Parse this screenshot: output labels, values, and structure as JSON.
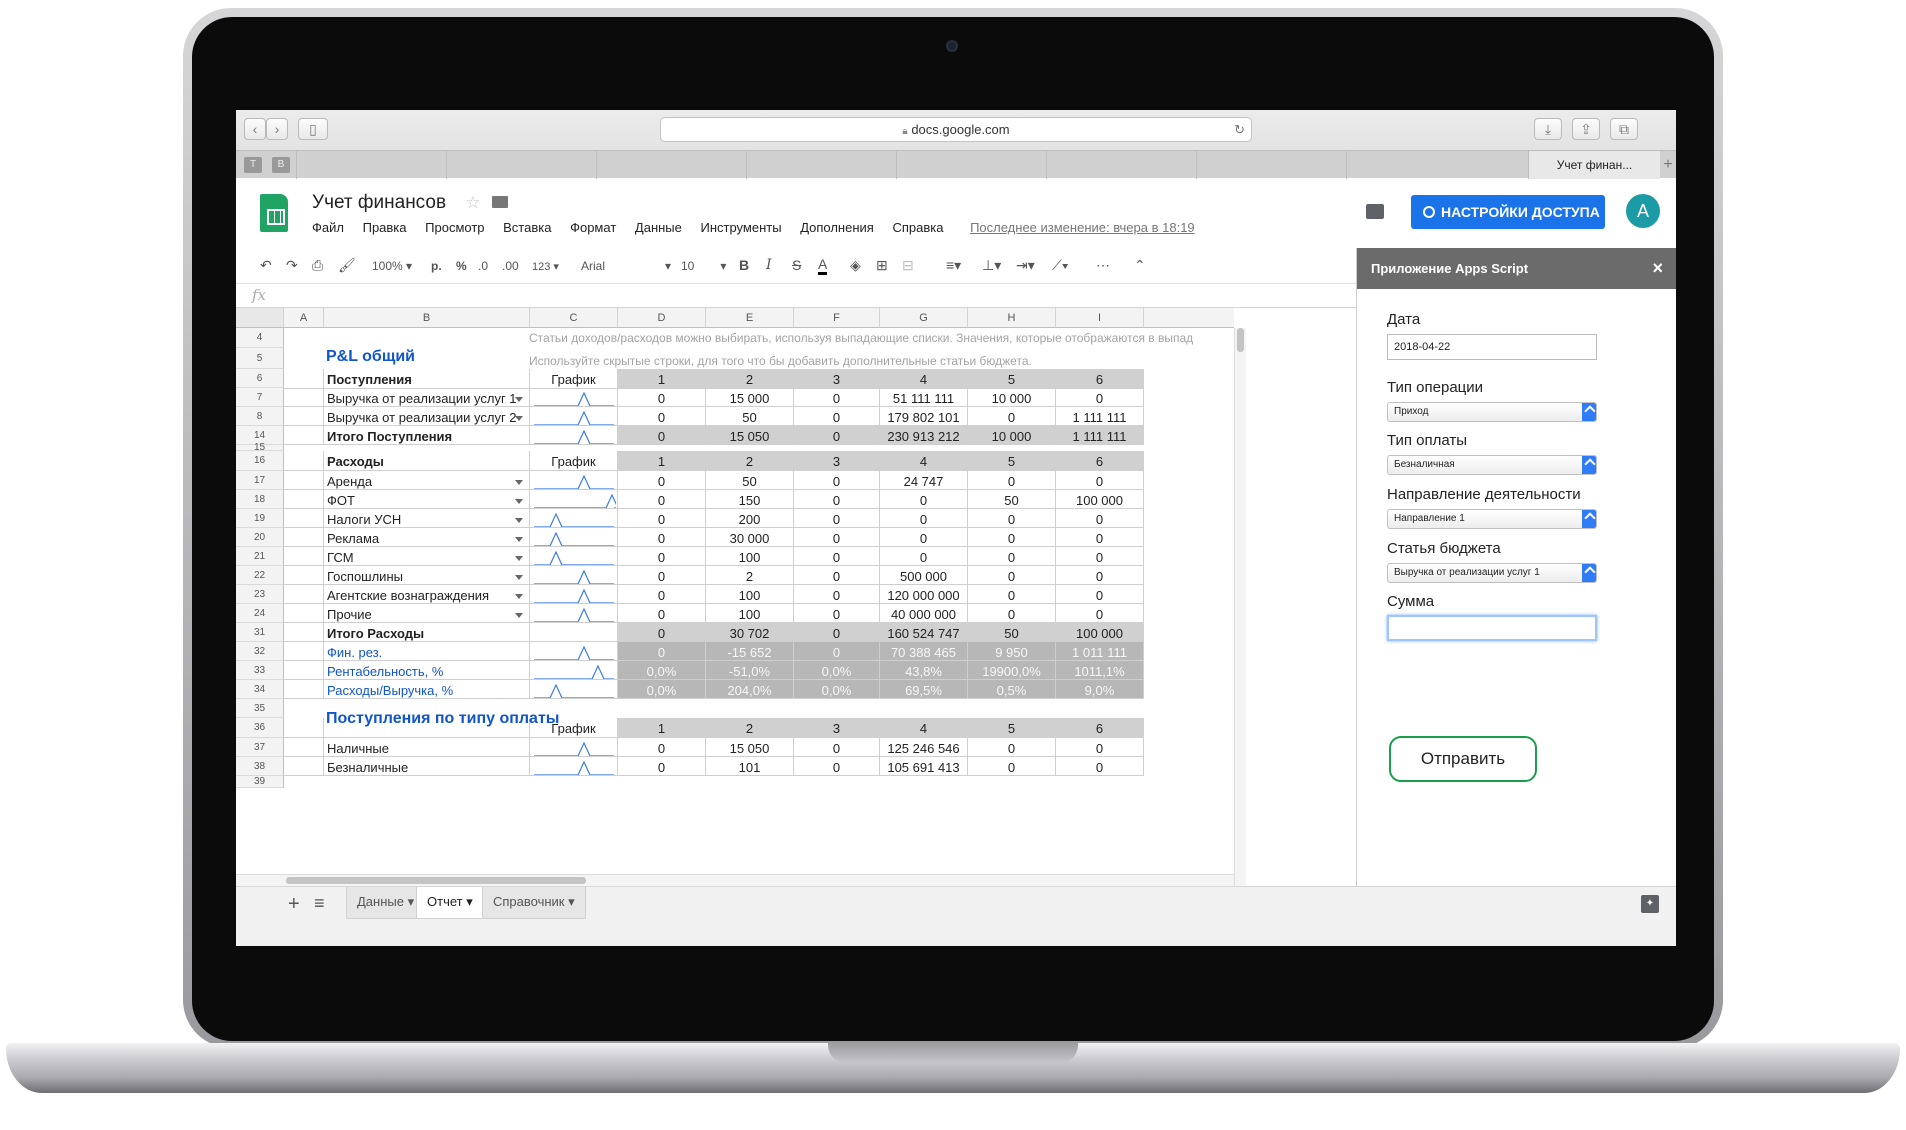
{
  "browser": {
    "url": "docs.google.com",
    "tab_title": "Учет финан...",
    "favicons": [
      "T",
      "B"
    ]
  },
  "header": {
    "title": "Учет финансов",
    "menu": [
      "Файл",
      "Правка",
      "Просмотр",
      "Вставка",
      "Формат",
      "Данные",
      "Инструменты",
      "Дополнения",
      "Справка"
    ],
    "last_edit": "Последнее изменение: вчера в 18:19",
    "share_label": "НАСТРОЙКИ ДОСТУПА",
    "avatar_letter": "A"
  },
  "toolbar": {
    "zoom": "100%",
    "currency": "р.",
    "percent": "%",
    "dec_less": ".0",
    "dec_more": ".00",
    "more_formats": "123",
    "font": "Arial",
    "size": "10",
    "bold": "B",
    "italic": "I",
    "strike": "S",
    "text_color": "A"
  },
  "formula_bar": {
    "fx": "fx",
    "value": ""
  },
  "grid": {
    "columns": [
      "A",
      "B",
      "C",
      "D",
      "E",
      "F",
      "G",
      "H",
      "I"
    ],
    "hint_line1": "Статьи доходов/расходов можно выбирать, используя выпадающие списки. Значения, которые отображаются в выпад",
    "hint_line2": "Используйте скрытые строки, для того что бы добавить дополнительные статьи бюджета.",
    "section_title": "P&L общий",
    "income": {
      "header": {
        "label": "Поступления",
        "chart": "График",
        "periods": [
          "1",
          "2",
          "3",
          "4",
          "5",
          "6"
        ]
      },
      "rows": [
        {
          "num": "7",
          "label": "Выручка от реализации услуг 1",
          "values": [
            "0",
            "15 000",
            "0",
            "51 111 111",
            "10 000",
            "0"
          ]
        },
        {
          "num": "8",
          "label": "Выручка от реализации услуг 2",
          "values": [
            "0",
            "50",
            "0",
            "179 802 101",
            "0",
            "1 111 111"
          ]
        }
      ],
      "total": {
        "num": "14",
        "label": "Итого Поступления",
        "values": [
          "0",
          "15 050",
          "0",
          "230 913 212",
          "10 000",
          "1 111 111"
        ]
      }
    },
    "expenses": {
      "header": {
        "label": "Расходы",
        "chart": "График",
        "periods": [
          "1",
          "2",
          "3",
          "4",
          "5",
          "6"
        ]
      },
      "rows": [
        {
          "num": "17",
          "label": "Аренда",
          "values": [
            "0",
            "50",
            "0",
            "24 747",
            "0",
            "0"
          ]
        },
        {
          "num": "18",
          "label": "ФОТ",
          "values": [
            "0",
            "150",
            "0",
            "0",
            "50",
            "100 000"
          ]
        },
        {
          "num": "19",
          "label": "Налоги УСН",
          "values": [
            "0",
            "200",
            "0",
            "0",
            "0",
            "0"
          ]
        },
        {
          "num": "20",
          "label": "Реклама",
          "values": [
            "0",
            "30 000",
            "0",
            "0",
            "0",
            "0"
          ]
        },
        {
          "num": "21",
          "label": "ГСМ",
          "values": [
            "0",
            "100",
            "0",
            "0",
            "0",
            "0"
          ]
        },
        {
          "num": "22",
          "label": "Госпошлины",
          "values": [
            "0",
            "2",
            "0",
            "500 000",
            "0",
            "0"
          ]
        },
        {
          "num": "23",
          "label": "Агентские вознаграждения",
          "values": [
            "0",
            "100",
            "0",
            "120 000 000",
            "0",
            "0"
          ]
        },
        {
          "num": "24",
          "label": "Прочие",
          "values": [
            "0",
            "100",
            "0",
            "40 000 000",
            "0",
            "0"
          ]
        }
      ],
      "total": {
        "num": "31",
        "label": "Итого Расходы",
        "values": [
          "0",
          "30 702",
          "0",
          "160 524 747",
          "50",
          "100 000"
        ]
      }
    },
    "metrics": [
      {
        "num": "32",
        "label": "Фин. рез.",
        "values": [
          "0",
          "-15 652",
          "0",
          "70 388 465",
          "9 950",
          "1 011 111"
        ]
      },
      {
        "num": "33",
        "label": "Рентабельность, %",
        "values": [
          "0,0%",
          "-51,0%",
          "0,0%",
          "43,8%",
          "19900,0%",
          "1011,1%"
        ]
      },
      {
        "num": "34",
        "label": "Расходы/Выручка, %",
        "values": [
          "0,0%",
          "204,0%",
          "0,0%",
          "69,5%",
          "0,5%",
          "9,0%"
        ]
      }
    ],
    "payment": {
      "title": "Поступления по типу оплаты",
      "chart": "График",
      "periods": [
        "1",
        "2",
        "3",
        "4",
        "5",
        "6"
      ],
      "rows": [
        {
          "num": "37",
          "label": "Наличные",
          "values": [
            "0",
            "15 050",
            "0",
            "125 246 546",
            "0",
            "0"
          ]
        },
        {
          "num": "38",
          "label": "Безналичные",
          "values": [
            "0",
            "101",
            "0",
            "105 691 413",
            "0",
            "0"
          ]
        }
      ]
    },
    "row_numbers": {
      "r4": "4",
      "r5": "5",
      "r6": "6",
      "r15": "15",
      "r16": "16",
      "r35": "35",
      "r36": "36",
      "r39": "39"
    }
  },
  "sheets": {
    "tabs": [
      "Данные",
      "Отчет",
      "Справочник"
    ],
    "active": "Отчет",
    "add": "+",
    "list": "≡"
  },
  "sidebar": {
    "title": "Приложение Apps Script",
    "close": "×",
    "date_label": "Дата",
    "date_value": "2018-04-22",
    "op_type_label": "Тип операции",
    "op_type_value": "Приход",
    "pay_type_label": "Тип оплаты",
    "pay_type_value": "Безналичная",
    "direction_label": "Направление деятельности",
    "direction_value": "Направление 1",
    "budget_label": "Статья бюджета",
    "budget_value": "Выручка от реализации услуг 1",
    "amount_label": "Сумма",
    "amount_value": "",
    "submit_label": "Отправить"
  }
}
